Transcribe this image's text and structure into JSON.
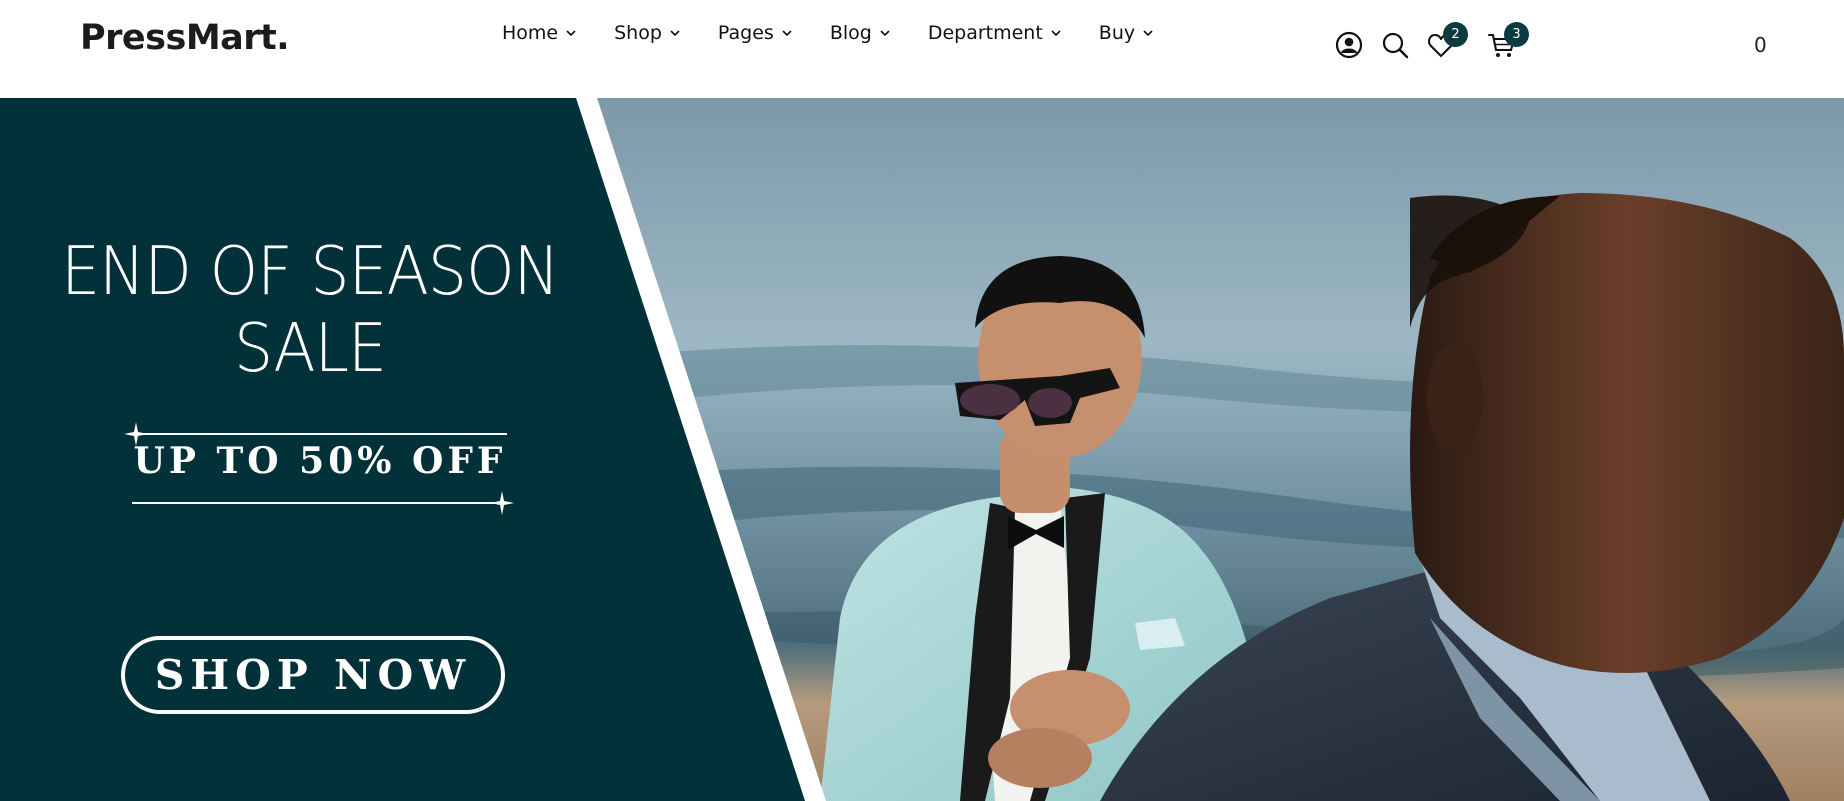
{
  "header": {
    "logo": "PressMart.",
    "nav": [
      {
        "label": "Home"
      },
      {
        "label": "Shop"
      },
      {
        "label": "Pages"
      },
      {
        "label": "Blog"
      },
      {
        "label": "Department"
      },
      {
        "label": "Buy"
      }
    ],
    "icons": {
      "account": "user-circle-icon",
      "search": "search-icon",
      "wishlist": "heart-icon",
      "cart": "cart-icon"
    },
    "wishlist_count": "2",
    "cart_count": "3",
    "cart_total": "0"
  },
  "hero": {
    "headline_line1": "END OF SEASON",
    "headline_line2": "SALE",
    "discount": "UP TO 50% OFF",
    "cta": "SHOP NOW"
  },
  "colors": {
    "brand_dark": "#02313a",
    "badge": "#0b3a40",
    "white": "#ffffff"
  }
}
